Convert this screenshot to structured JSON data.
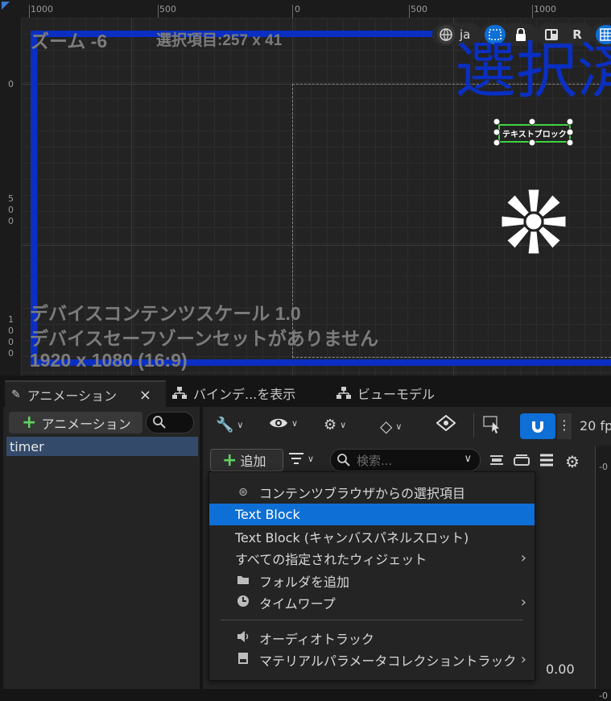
{
  "designer": {
    "zoom": "ズーム -6",
    "selection": "選択項目:257 x 41",
    "big_text": "選択済",
    "text_block_label": "テキストブロック",
    "scale_line1": "デバイスコンテンツスケール 1.0",
    "scale_line2": "デバイスセーフゾーンセットがありません",
    "resolution": "1920 x 1080 (16:9)",
    "lang_button": "ja",
    "r_button": "R",
    "ruler_top": [
      "1000",
      "500",
      "0",
      "500",
      "1000"
    ],
    "ruler_left_0": "0",
    "ruler_left_500": [
      "5",
      "0",
      "0"
    ],
    "ruler_left_1000": [
      "1",
      "0",
      "0",
      "0"
    ],
    "colors": {
      "accent_blue": "#0a2fc2",
      "selected": "#0e6fd6",
      "green": "#5fd35f"
    }
  },
  "tabs": [
    {
      "label": "アニメーション",
      "icon": "pencil-icon",
      "close": "×"
    },
    {
      "label": "バインデ...を表示",
      "icon": "hierarchy-icon"
    },
    {
      "label": "ビューモデル",
      "icon": "hierarchy-icon"
    }
  ],
  "left_panel": {
    "add_label": "アニメーション",
    "items": [
      "timer"
    ]
  },
  "toolbar": {
    "fps": "20 fp"
  },
  "track_bar": {
    "add_label": "追加",
    "search_placeholder": "検索..."
  },
  "menu": {
    "items": [
      {
        "label": "コンテンツブラウザからの選択項目",
        "icon": "content-browser-icon",
        "submenu": false
      },
      {
        "label": "Text Block",
        "selected": true,
        "submenu": false
      },
      {
        "label": "Text Block (キャンバスパネルスロット)",
        "submenu": false
      },
      {
        "label": "すべての指定されたウィジェット",
        "submenu": true
      },
      {
        "label": "フォルダを追加",
        "icon": "folder-icon",
        "submenu": false
      },
      {
        "label": "タイムワープ",
        "icon": "clock-icon",
        "submenu": true
      },
      {
        "label": "オーディオトラック",
        "icon": "speaker-icon",
        "submenu": false
      },
      {
        "label": "マテリアルパラメータコレクショントラック",
        "icon": "material-icon",
        "submenu": true
      }
    ]
  },
  "time_value": "0.00",
  "track_tick_top": "-0",
  "track_tick_bottom": "-0"
}
